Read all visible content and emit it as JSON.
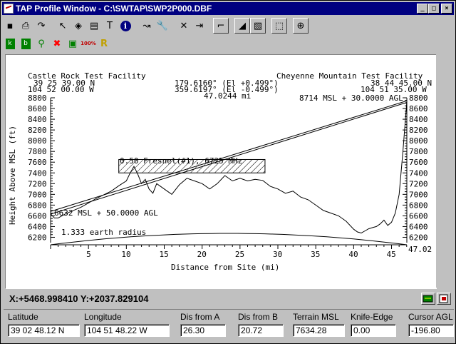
{
  "window": {
    "title": "TAP Profile Window - C:\\SWTAP\\SWP2P000.DBF",
    "min": "_",
    "max": "□",
    "close": "×"
  },
  "toolbar1": [
    {
      "name": "save-icon",
      "glyph": "▪"
    },
    {
      "name": "print-icon",
      "glyph": "⎙"
    },
    {
      "name": "redo-icon",
      "glyph": "↷"
    },
    {
      "name": "pointer-icon",
      "glyph": "↖"
    },
    {
      "name": "fill-icon",
      "glyph": "◈"
    },
    {
      "name": "edit-tool-icon",
      "glyph": "▤"
    },
    {
      "name": "text-tool-icon",
      "glyph": "T"
    },
    {
      "name": "info-icon",
      "glyph": "i"
    },
    {
      "name": "route-icon",
      "glyph": "↝"
    },
    {
      "name": "wrench-icon",
      "glyph": "🔧"
    },
    {
      "name": "close-x-icon",
      "glyph": "✕"
    },
    {
      "name": "exit-icon",
      "glyph": "⇥"
    },
    {
      "name": "profile-green-icon",
      "glyph": "⌐"
    },
    {
      "name": "profile-fill-icon",
      "glyph": "◢"
    },
    {
      "name": "profile-hatch-icon",
      "glyph": "▧"
    },
    {
      "name": "cursor-tool-icon",
      "glyph": "⬚"
    },
    {
      "name": "crosshair-icon",
      "glyph": "⊕"
    }
  ],
  "toolbar2": [
    {
      "name": "site-a-icon",
      "glyph": "k"
    },
    {
      "name": "site-b-icon",
      "glyph": "b"
    },
    {
      "name": "zoom-icon",
      "glyph": "⚲"
    },
    {
      "name": "delete-icon",
      "glyph": "✖"
    },
    {
      "name": "obstruction-icon",
      "glyph": "▣"
    },
    {
      "name": "zoom-100-icon",
      "glyph": "100%"
    },
    {
      "name": "refraction-icon",
      "glyph": "R"
    }
  ],
  "plot": {
    "site_a": {
      "name": "Castle Rock Test Facility",
      "lat": "39 25 39.00 N",
      "lon": "104 52 00.00 W"
    },
    "site_b": {
      "name": "Cheyenne Mountain Test Facility",
      "lat": "38 44 45.00 N",
      "lon": "104 51 35.00 W"
    },
    "angle_a": "179.6160° (El +0.499°)",
    "angle_b": "359.6197° (El -0.499°)",
    "distance": "47.0244 mi",
    "antenna_b": "8714 MSL + 30.0000 AGL",
    "antenna_a": "6632 MSL + 50.0000 AGL",
    "fresnel": "0.50 Fresnel(#1), 6725 MHz",
    "earth": "1.333 earth radius",
    "ylabel": "Height Above MSL (ft)",
    "xlabel": "Distance from Site (mi)",
    "end_mark": "47.02"
  },
  "chart_data": {
    "type": "line",
    "xlabel": "Distance from Site (mi)",
    "ylabel": "Height Above MSL (ft)",
    "xlim": [
      0,
      47.02
    ],
    "ylim": [
      6100,
      8800
    ],
    "x_ticks": [
      5,
      10,
      15,
      20,
      25,
      30,
      35,
      40,
      45
    ],
    "y_ticks": [
      6200,
      6400,
      6600,
      6800,
      7000,
      7200,
      7400,
      7600,
      7800,
      8000,
      8200,
      8400,
      8600,
      8800
    ],
    "series": [
      {
        "values_x": [
          0,
          0.5,
          1,
          2,
          3,
          4,
          5,
          6,
          7,
          8,
          9,
          10,
          10.5,
          11,
          11.5,
          12,
          12.5,
          13,
          13.5,
          14,
          15,
          16,
          17,
          18,
          19,
          20,
          21,
          22,
          23,
          24,
          25,
          26,
          27,
          28,
          29,
          30,
          31,
          32,
          33,
          34,
          35,
          36,
          37,
          38,
          39,
          40,
          40.5,
          41,
          41.5,
          42,
          42.5,
          43,
          43.5,
          44,
          44.5,
          45,
          45.5,
          46,
          46.5,
          47
        ],
        "values_y": [
          6640,
          6560,
          6560,
          6640,
          6700,
          6760,
          6840,
          6920,
          6990,
          7060,
          7160,
          7250,
          7400,
          7520,
          7380,
          7200,
          7280,
          7100,
          7020,
          7200,
          7100,
          7000,
          7180,
          7300,
          7250,
          7200,
          7100,
          7200,
          7350,
          7250,
          7300,
          7250,
          7280,
          7260,
          7150,
          7100,
          7020,
          7060,
          6950,
          6900,
          6800,
          6700,
          6650,
          6600,
          6500,
          6350,
          6300,
          6280,
          6320,
          6360,
          6380,
          6400,
          6450,
          6520,
          6420,
          6480,
          6650,
          7000,
          7800,
          8700
        ]
      }
    ],
    "los_a": [
      6632,
      6682
    ],
    "los_b": [
      8714,
      8744
    ],
    "fresnel_zone": {
      "x": [
        9,
        28.3
      ],
      "y": [
        7400,
        7650
      ]
    }
  },
  "readout": "X:+5468.998410 Y:+2037.829104",
  "fields": [
    {
      "label": "Latitude",
      "value": "39 02 48.12 N"
    },
    {
      "label": "Longitude",
      "value": "104 51 48.22 W"
    },
    {
      "label": "Dis from A",
      "value": "26.30"
    },
    {
      "label": "Dis from B",
      "value": "20.72"
    },
    {
      "label": "Terrain MSL",
      "value": "7634.28"
    },
    {
      "label": "Knife-Edge",
      "value": "0.00"
    },
    {
      "label": "Cursor AGL",
      "value": "-196.80"
    }
  ],
  "colors": {
    "titlebar": "#000080",
    "face": "#c0c0c0"
  }
}
